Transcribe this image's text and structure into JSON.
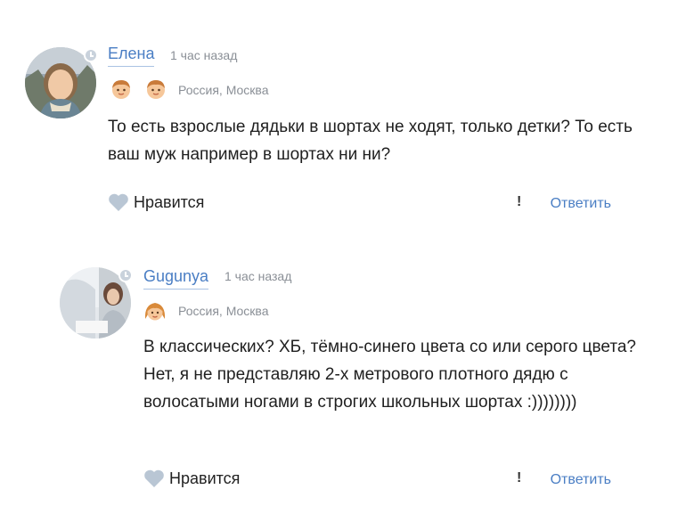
{
  "comments": [
    {
      "author": "Елена",
      "time": "1 час назад",
      "location": "Россия, Москва",
      "text": "То есть взрослые дядьки в шортах не ходят, только детки? То есть ваш муж например в шортах ни ни?",
      "like_label": "Нравится",
      "report_label": "!",
      "reply_label": "Ответить",
      "children_icons": [
        "boy-icon",
        "boy-icon"
      ]
    },
    {
      "author": "Gugunya",
      "time": "1 час назад",
      "location": "Россия, Москва",
      "text": "В классических? ХБ, тёмно-синего цвета со или серого цвета? Нет, я не представляю 2-х метрового плотного дядю с волосатыми ногами в строгих школьных шортах :))))))))",
      "like_label": "Нравится",
      "report_label": "!",
      "reply_label": "Ответить",
      "children_icons": [
        "girl-icon"
      ]
    }
  ],
  "colors": {
    "link": "#4a7ec4",
    "muted": "#8a8f96",
    "heart": "#b9c6d4"
  }
}
